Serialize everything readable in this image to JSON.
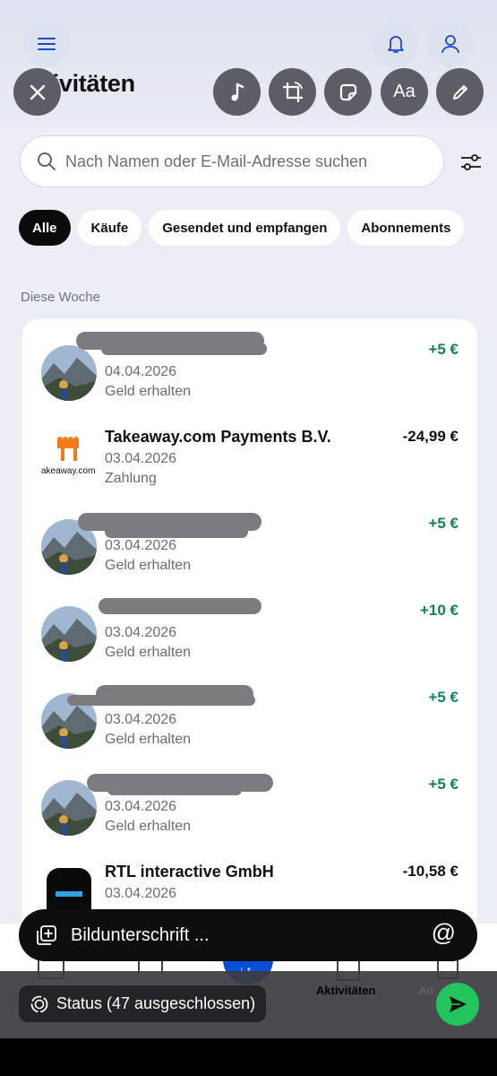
{
  "header": {
    "title": "Aktivitäten",
    "title_visible": "tivitäten"
  },
  "search": {
    "placeholder": "Nach Namen oder E-Mail-Adresse suchen"
  },
  "filters": [
    {
      "label": "Alle",
      "active": true
    },
    {
      "label": "Käufe",
      "active": false
    },
    {
      "label": "Gesendet und empfangen",
      "active": false
    },
    {
      "label": "Abonnements",
      "active": false
    }
  ],
  "section": {
    "label": "Diese Woche"
  },
  "transactions": [
    {
      "name": "",
      "date": "04.04.2026",
      "type": "Geld erhalten",
      "amount": "+5 €",
      "positive": true,
      "logo": "avatar-photo"
    },
    {
      "name": "Takeaway.com Payments B.V.",
      "date": "03.04.2026",
      "type": "Zahlung",
      "amount": "-24,99 €",
      "positive": false,
      "logo": "takeaway-logo"
    },
    {
      "name": "",
      "date": "03.04.2026",
      "type": "Geld erhalten",
      "amount": "+5 €",
      "positive": true,
      "logo": "avatar-photo"
    },
    {
      "name": "",
      "date": "03.04.2026",
      "type": "Geld erhalten",
      "amount": "+10 €",
      "positive": true,
      "logo": "avatar-photo"
    },
    {
      "name": "",
      "date": "03.04.2026",
      "type": "Geld erhalten",
      "amount": "+5 €",
      "positive": true,
      "logo": "avatar-photo"
    },
    {
      "name": "",
      "date": "03.04.2026",
      "type": "Geld erhalten",
      "amount": "+5 €",
      "positive": true,
      "logo": "avatar-photo"
    },
    {
      "name": "RTL interactive GmbH",
      "date": "03.04.2026",
      "type": "",
      "amount": "-10,58 €",
      "positive": false,
      "logo": "rtl-logo"
    }
  ],
  "takeaway_logo_text": "akeaway.com",
  "editor": {
    "tools": [
      "close-icon",
      "music-icon",
      "crop-rotate-icon",
      "sticker-icon",
      "text-icon",
      "pen-icon"
    ],
    "text_tool_label": "Aa",
    "caption_placeholder": "Bildunterschrift ...",
    "mention_symbol": "@",
    "status_label": "Status (47 ausgeschlossen)"
  },
  "nav": {
    "active_label": "Aktivitäten",
    "partial_label": "An"
  },
  "colors": {
    "positive": "#13805a",
    "accent_blue": "#0a4dd6",
    "send_green": "#22c45e"
  }
}
